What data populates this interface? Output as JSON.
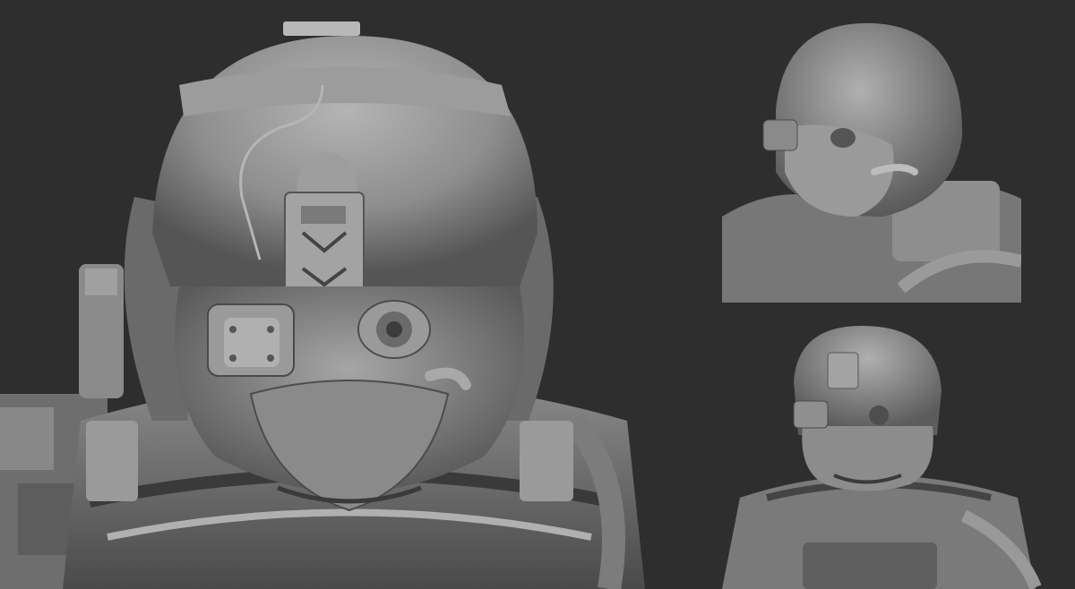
{
  "scene": {
    "background_color": "#2e2e2e",
    "clay_light": "#a8a8a8",
    "clay_mid": "#8a8a8a",
    "clay_dark": "#5e5e5e",
    "clay_shadow": "#3c3c3c",
    "views": [
      {
        "name": "front-closeup-view",
        "subject": "helmeted-character-sculpt"
      },
      {
        "name": "three-quarter-view",
        "subject": "helmeted-character-sculpt"
      },
      {
        "name": "bust-view",
        "subject": "helmeted-character-sculpt"
      }
    ]
  }
}
